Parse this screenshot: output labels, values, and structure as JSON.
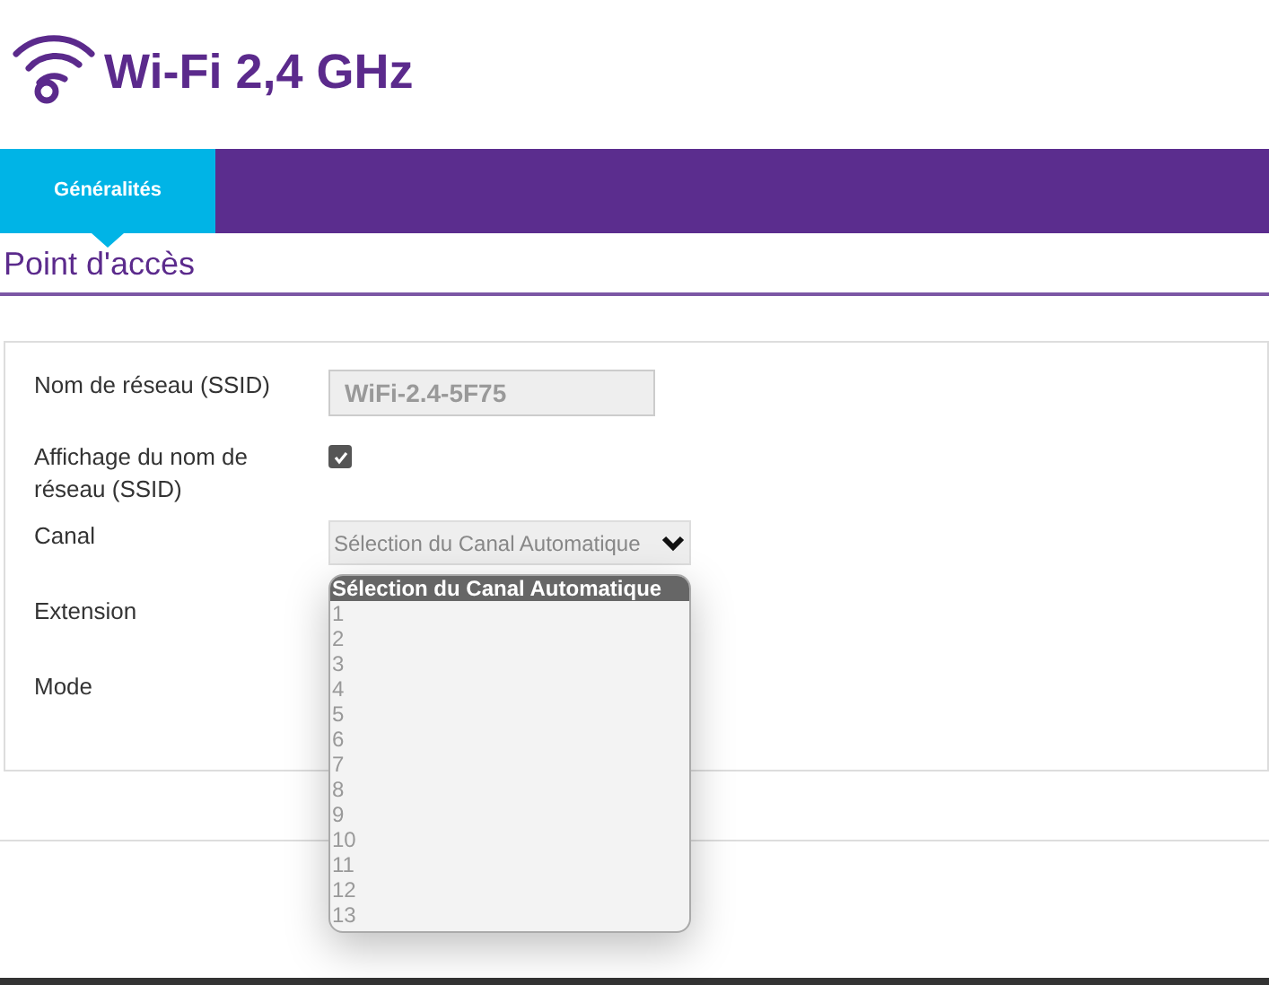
{
  "page": {
    "title": "Wi-Fi 2,4 GHz"
  },
  "tabs": [
    {
      "label": "Généralités",
      "selected": true
    }
  ],
  "section": {
    "title": "Point d'accès"
  },
  "form": {
    "rows": [
      {
        "kind": "text",
        "label": "Nom de réseau (SSID)",
        "value": "WiFi-2.4-5F75",
        "disabled": true
      },
      {
        "kind": "checkbox",
        "label": "Affichage du nom de réseau (SSID)",
        "checked": true
      },
      {
        "kind": "select",
        "label": "Canal",
        "value": "Sélection du Canal Automatique",
        "options": [
          {
            "label": "Sélection du Canal Automatique",
            "selected": true
          },
          {
            "label": "1",
            "selected": false
          },
          {
            "label": "2",
            "selected": false
          },
          {
            "label": "3",
            "selected": false
          },
          {
            "label": "4",
            "selected": false
          },
          {
            "label": "5",
            "selected": false
          },
          {
            "label": "6",
            "selected": false
          },
          {
            "label": "7",
            "selected": false
          },
          {
            "label": "8",
            "selected": false
          },
          {
            "label": "9",
            "selected": false
          },
          {
            "label": "10",
            "selected": false
          },
          {
            "label": "11",
            "selected": false
          },
          {
            "label": "12",
            "selected": false
          },
          {
            "label": "13",
            "selected": false
          }
        ]
      },
      {
        "kind": "label",
        "label": "Extension"
      },
      {
        "kind": "label",
        "label": "Mode"
      }
    ]
  }
}
